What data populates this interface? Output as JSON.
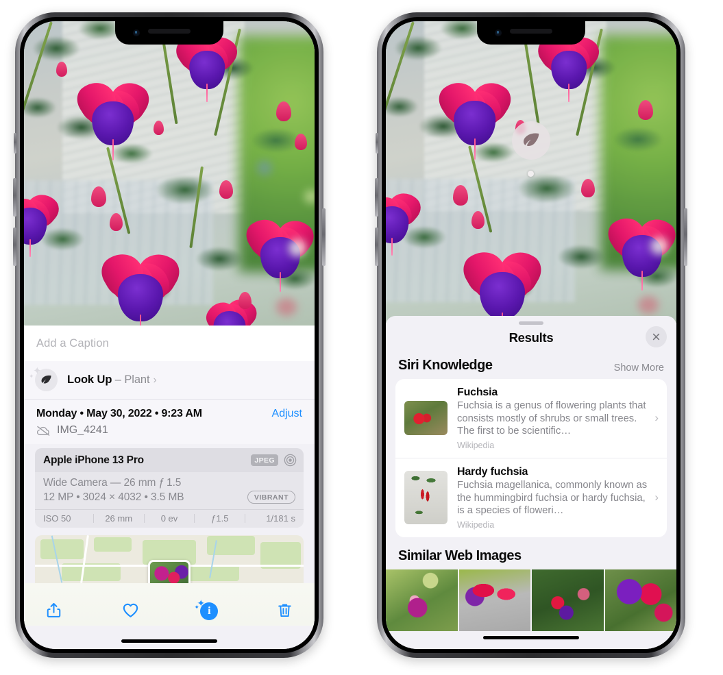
{
  "left_phone": {
    "photo": {
      "alt": "fuchsia-flowers-photo"
    },
    "caption_placeholder": "Add a Caption",
    "caption_value": "",
    "look_up": {
      "icon": "leaf-icon",
      "label": "Look Up",
      "dash": " – ",
      "subject": "Plant",
      "chevron": "›"
    },
    "meta": {
      "date_line": "Monday • May 30, 2022 • 9:23 AM",
      "adjust_label": "Adjust",
      "cloud_icon": "cloud-slash-icon",
      "filename": "IMG_4241"
    },
    "exif": {
      "device": "Apple iPhone 13 Pro",
      "format_badge": "JPEG",
      "raw_icon": "raw-circle-icon",
      "lens_line": "Wide Camera — 26 mm ƒ 1.5",
      "size_line": "12 MP • 3024 × 4032 • 3.5 MB",
      "style_badge": "VIBRANT",
      "stats": [
        "ISO 50",
        "26 mm",
        "0 ev",
        "ƒ1.5",
        "1/181 s"
      ]
    },
    "toolbar": {
      "share_icon": "share-icon",
      "favorite_icon": "heart-icon",
      "info_icon": "info-sparkle-icon",
      "delete_icon": "trash-icon"
    }
  },
  "right_phone": {
    "visual_lookup_badge": {
      "icon": "leaf-icon"
    },
    "sheet": {
      "title": "Results",
      "close_icon": "close-icon",
      "grabber": "drag-handle"
    },
    "siri_knowledge": {
      "section_title": "Siri Knowledge",
      "show_more": "Show More",
      "items": [
        {
          "title": "Fuchsia",
          "description": "Fuchsia is a genus of flowering plants that consists mostly of shrubs or small trees. The first to be scientific…",
          "source": "Wikipedia",
          "chevron": "›"
        },
        {
          "title": "Hardy fuchsia",
          "description": "Fuchsia magellanica, commonly known as the hummingbird fuchsia or hardy fuchsia, is a species of floweri…",
          "source": "Wikipedia",
          "chevron": "›"
        }
      ]
    },
    "similar_web_images": {
      "section_title": "Similar Web Images",
      "count": 4
    }
  },
  "colors": {
    "accent_blue": "#1e8fff",
    "panel_bg": "#f2f1f6",
    "card_bg": "#ffffff",
    "secondary_text": "#8a8a90",
    "exif_bg": "#e7e6eb"
  }
}
